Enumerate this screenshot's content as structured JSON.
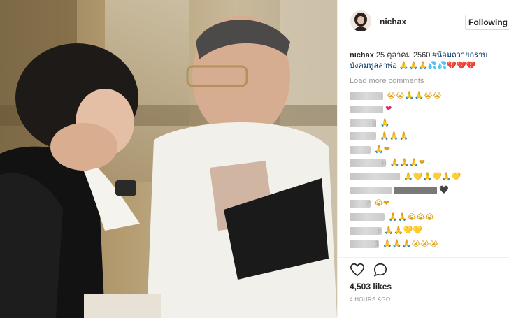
{
  "post": {
    "username": "nichax",
    "follow_label": "Following",
    "caption_user": "nichax",
    "caption_text": "25 ตุลาคม 2560",
    "caption_hashtag": "#น้อมถวายกราบ",
    "caption_line2": "บังคมทูลลาพ่อ",
    "caption_emoji": "🙏🙏🙏💦💦💔💔💔",
    "load_more": "Load more comments",
    "likes": "4,503 likes",
    "timestamp": "4 HOURS AGO"
  },
  "comments": [
    {
      "name_fragment": "",
      "emoji": "😭😭🙏🙏😭😭"
    },
    {
      "name_fragment": "",
      "emoji": "❤"
    },
    {
      "name_fragment": "g",
      "emoji": "🙏"
    },
    {
      "name_fragment": "",
      "emoji": "🙏🙏🙏"
    },
    {
      "name_fragment": "",
      "emoji": "🙏❤"
    },
    {
      "name_fragment": "n",
      "emoji": "🙏🙏🙏❤"
    },
    {
      "name_fragment": "",
      "emoji": "🙏💛🙏💛🙏💛"
    },
    {
      "name_fragment": "",
      "emoji": "🖤"
    },
    {
      "name_fragment": "2",
      "emoji": "😭❤"
    },
    {
      "name_fragment": "",
      "emoji": "🙏🙏😭😭😭"
    },
    {
      "name_fragment": "r",
      "emoji": "🙏🙏💛💛"
    },
    {
      "name_fragment": "1",
      "emoji": "🙏🙏🙏😭😭😭"
    }
  ],
  "icons": {
    "like": "heart-outline-icon",
    "comment": "speech-bubble-icon"
  },
  "colors": {
    "hashtag": "#003569",
    "muted": "#999999",
    "heart": "#e0245e"
  }
}
